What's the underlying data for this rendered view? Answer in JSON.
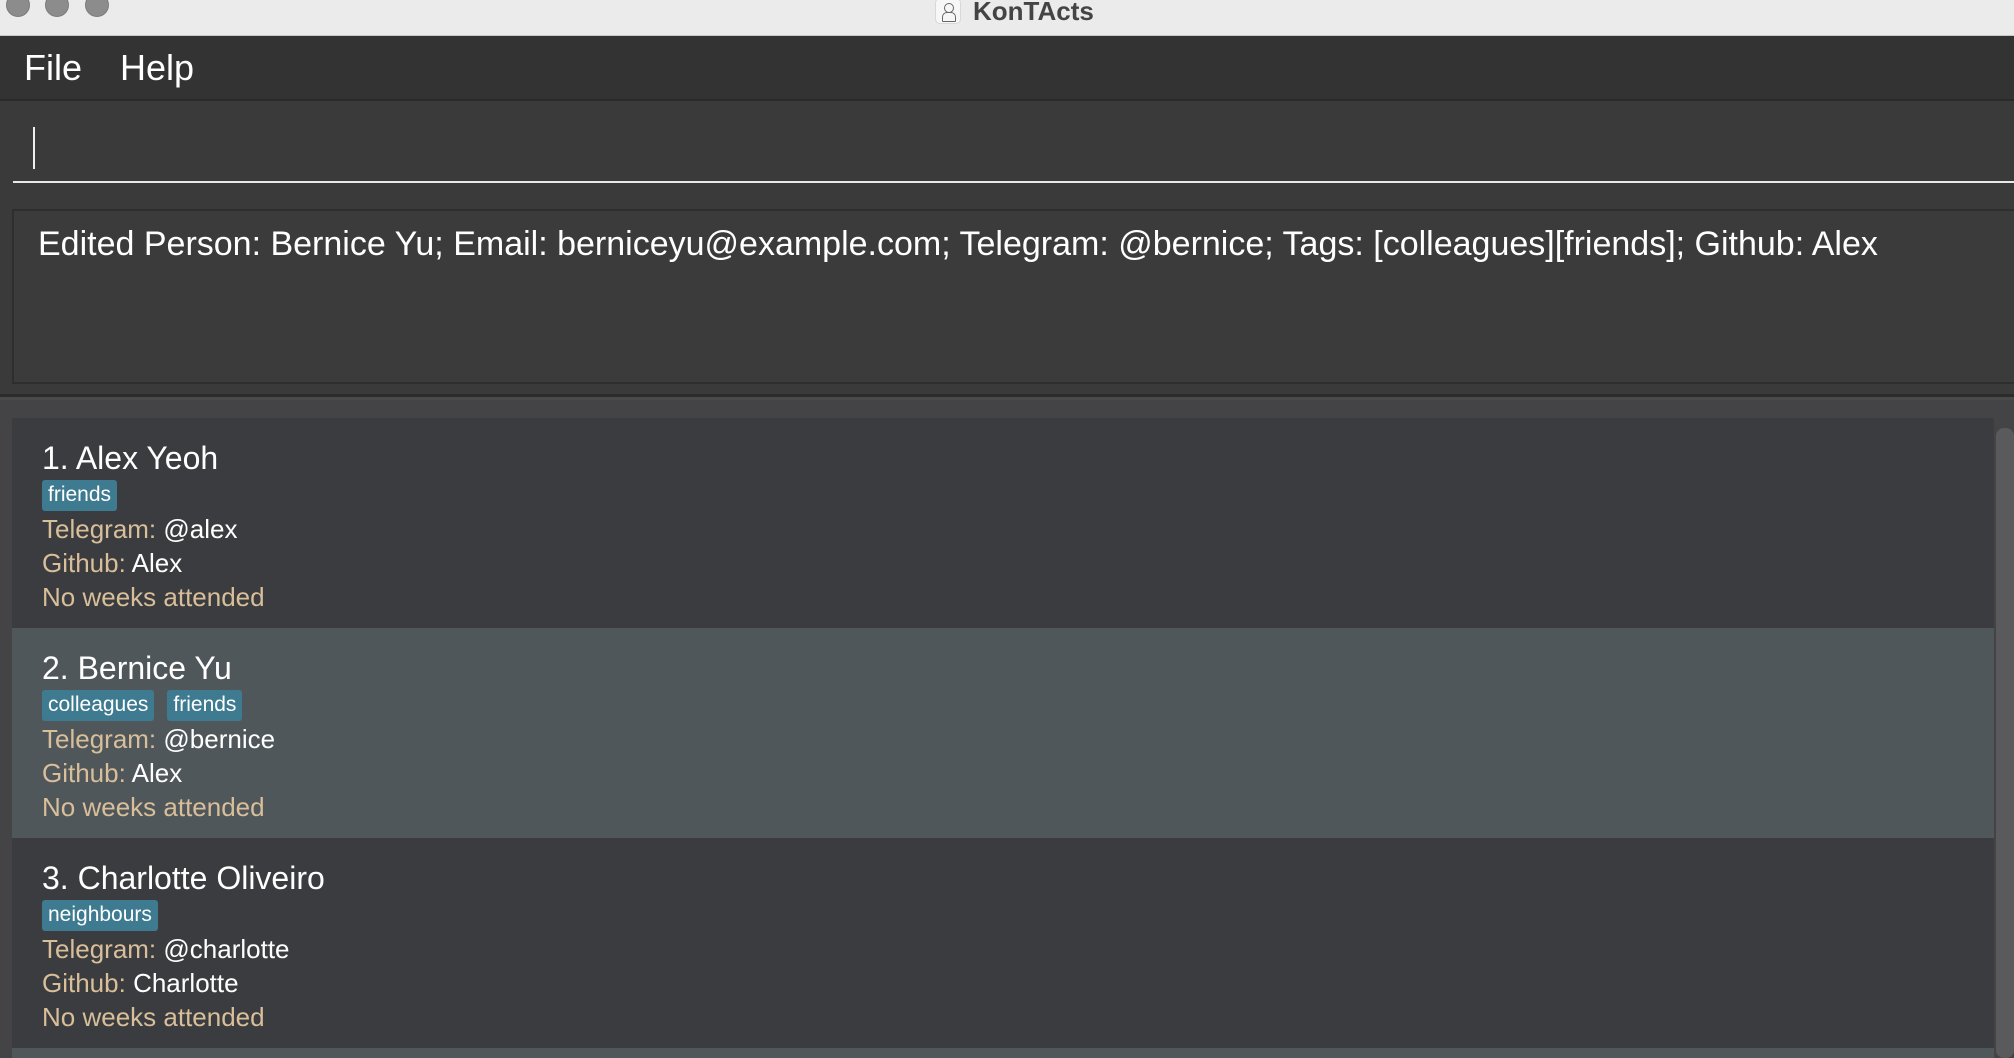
{
  "window": {
    "title": "KonTActs"
  },
  "menu": {
    "items": [
      "File",
      "Help"
    ]
  },
  "command_box": {
    "value": "",
    "placeholder": ""
  },
  "result_display": {
    "text": "Edited Person: Bernice Yu; Email: berniceyu@example.com; Telegram: @bernice; Tags: [colleagues][friends]; Github: Alex"
  },
  "persons": [
    {
      "index_name": "1. Alex Yeoh",
      "tags": [
        "friends"
      ],
      "telegram_label": "Telegram: ",
      "telegram": "@alex",
      "github_label": "Github: ",
      "github": "Alex",
      "attendance": "No weeks attended",
      "selected": false
    },
    {
      "index_name": "2. Bernice Yu",
      "tags": [
        "colleagues",
        "friends"
      ],
      "telegram_label": "Telegram: ",
      "telegram": "@bernice",
      "github_label": "Github: ",
      "github": "Alex",
      "attendance": "No weeks attended",
      "selected": true
    },
    {
      "index_name": "3. Charlotte Oliveiro",
      "tags": [
        "neighbours"
      ],
      "telegram_label": "Telegram: ",
      "telegram": "@charlotte",
      "github_label": "Github: ",
      "github": "Charlotte",
      "attendance": "No weeks attended",
      "selected": false
    }
  ],
  "colors": {
    "tag_background": "#3e7b91",
    "field_label": "#d8bf9a",
    "selected_card": "#50575b",
    "card": "#3b3c3f"
  },
  "icons": {
    "app": "app-logo-icon"
  }
}
